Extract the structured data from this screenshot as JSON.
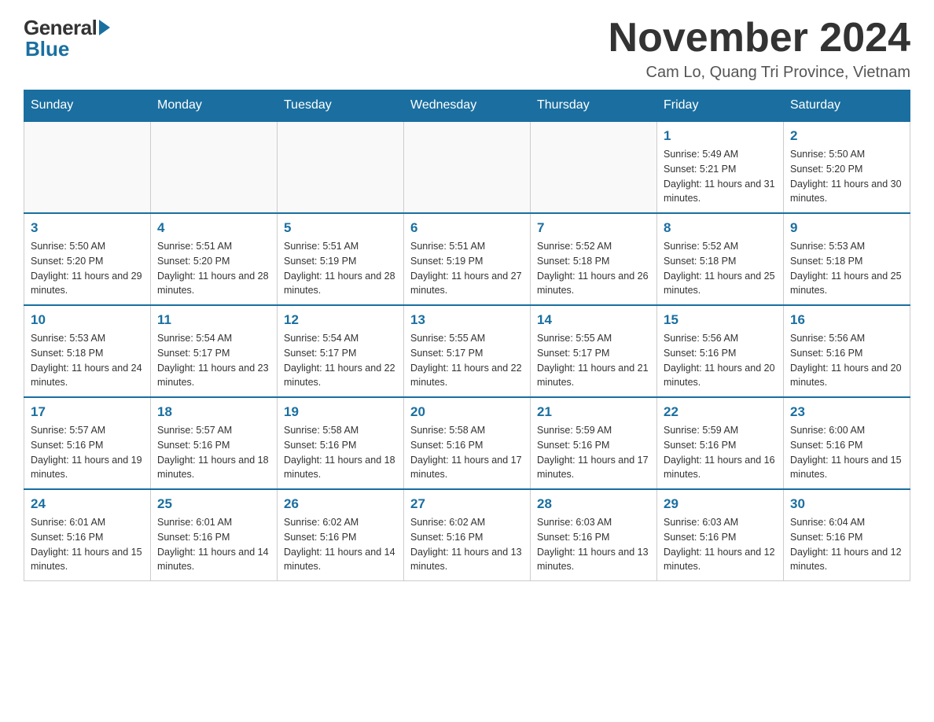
{
  "logo": {
    "general": "General",
    "blue": "Blue"
  },
  "title": "November 2024",
  "location": "Cam Lo, Quang Tri Province, Vietnam",
  "days_of_week": [
    "Sunday",
    "Monday",
    "Tuesday",
    "Wednesday",
    "Thursday",
    "Friday",
    "Saturday"
  ],
  "weeks": [
    [
      {
        "day": "",
        "info": ""
      },
      {
        "day": "",
        "info": ""
      },
      {
        "day": "",
        "info": ""
      },
      {
        "day": "",
        "info": ""
      },
      {
        "day": "",
        "info": ""
      },
      {
        "day": "1",
        "info": "Sunrise: 5:49 AM\nSunset: 5:21 PM\nDaylight: 11 hours and 31 minutes."
      },
      {
        "day": "2",
        "info": "Sunrise: 5:50 AM\nSunset: 5:20 PM\nDaylight: 11 hours and 30 minutes."
      }
    ],
    [
      {
        "day": "3",
        "info": "Sunrise: 5:50 AM\nSunset: 5:20 PM\nDaylight: 11 hours and 29 minutes."
      },
      {
        "day": "4",
        "info": "Sunrise: 5:51 AM\nSunset: 5:20 PM\nDaylight: 11 hours and 28 minutes."
      },
      {
        "day": "5",
        "info": "Sunrise: 5:51 AM\nSunset: 5:19 PM\nDaylight: 11 hours and 28 minutes."
      },
      {
        "day": "6",
        "info": "Sunrise: 5:51 AM\nSunset: 5:19 PM\nDaylight: 11 hours and 27 minutes."
      },
      {
        "day": "7",
        "info": "Sunrise: 5:52 AM\nSunset: 5:18 PM\nDaylight: 11 hours and 26 minutes."
      },
      {
        "day": "8",
        "info": "Sunrise: 5:52 AM\nSunset: 5:18 PM\nDaylight: 11 hours and 25 minutes."
      },
      {
        "day": "9",
        "info": "Sunrise: 5:53 AM\nSunset: 5:18 PM\nDaylight: 11 hours and 25 minutes."
      }
    ],
    [
      {
        "day": "10",
        "info": "Sunrise: 5:53 AM\nSunset: 5:18 PM\nDaylight: 11 hours and 24 minutes."
      },
      {
        "day": "11",
        "info": "Sunrise: 5:54 AM\nSunset: 5:17 PM\nDaylight: 11 hours and 23 minutes."
      },
      {
        "day": "12",
        "info": "Sunrise: 5:54 AM\nSunset: 5:17 PM\nDaylight: 11 hours and 22 minutes."
      },
      {
        "day": "13",
        "info": "Sunrise: 5:55 AM\nSunset: 5:17 PM\nDaylight: 11 hours and 22 minutes."
      },
      {
        "day": "14",
        "info": "Sunrise: 5:55 AM\nSunset: 5:17 PM\nDaylight: 11 hours and 21 minutes."
      },
      {
        "day": "15",
        "info": "Sunrise: 5:56 AM\nSunset: 5:16 PM\nDaylight: 11 hours and 20 minutes."
      },
      {
        "day": "16",
        "info": "Sunrise: 5:56 AM\nSunset: 5:16 PM\nDaylight: 11 hours and 20 minutes."
      }
    ],
    [
      {
        "day": "17",
        "info": "Sunrise: 5:57 AM\nSunset: 5:16 PM\nDaylight: 11 hours and 19 minutes."
      },
      {
        "day": "18",
        "info": "Sunrise: 5:57 AM\nSunset: 5:16 PM\nDaylight: 11 hours and 18 minutes."
      },
      {
        "day": "19",
        "info": "Sunrise: 5:58 AM\nSunset: 5:16 PM\nDaylight: 11 hours and 18 minutes."
      },
      {
        "day": "20",
        "info": "Sunrise: 5:58 AM\nSunset: 5:16 PM\nDaylight: 11 hours and 17 minutes."
      },
      {
        "day": "21",
        "info": "Sunrise: 5:59 AM\nSunset: 5:16 PM\nDaylight: 11 hours and 17 minutes."
      },
      {
        "day": "22",
        "info": "Sunrise: 5:59 AM\nSunset: 5:16 PM\nDaylight: 11 hours and 16 minutes."
      },
      {
        "day": "23",
        "info": "Sunrise: 6:00 AM\nSunset: 5:16 PM\nDaylight: 11 hours and 15 minutes."
      }
    ],
    [
      {
        "day": "24",
        "info": "Sunrise: 6:01 AM\nSunset: 5:16 PM\nDaylight: 11 hours and 15 minutes."
      },
      {
        "day": "25",
        "info": "Sunrise: 6:01 AM\nSunset: 5:16 PM\nDaylight: 11 hours and 14 minutes."
      },
      {
        "day": "26",
        "info": "Sunrise: 6:02 AM\nSunset: 5:16 PM\nDaylight: 11 hours and 14 minutes."
      },
      {
        "day": "27",
        "info": "Sunrise: 6:02 AM\nSunset: 5:16 PM\nDaylight: 11 hours and 13 minutes."
      },
      {
        "day": "28",
        "info": "Sunrise: 6:03 AM\nSunset: 5:16 PM\nDaylight: 11 hours and 13 minutes."
      },
      {
        "day": "29",
        "info": "Sunrise: 6:03 AM\nSunset: 5:16 PM\nDaylight: 11 hours and 12 minutes."
      },
      {
        "day": "30",
        "info": "Sunrise: 6:04 AM\nSunset: 5:16 PM\nDaylight: 11 hours and 12 minutes."
      }
    ]
  ]
}
